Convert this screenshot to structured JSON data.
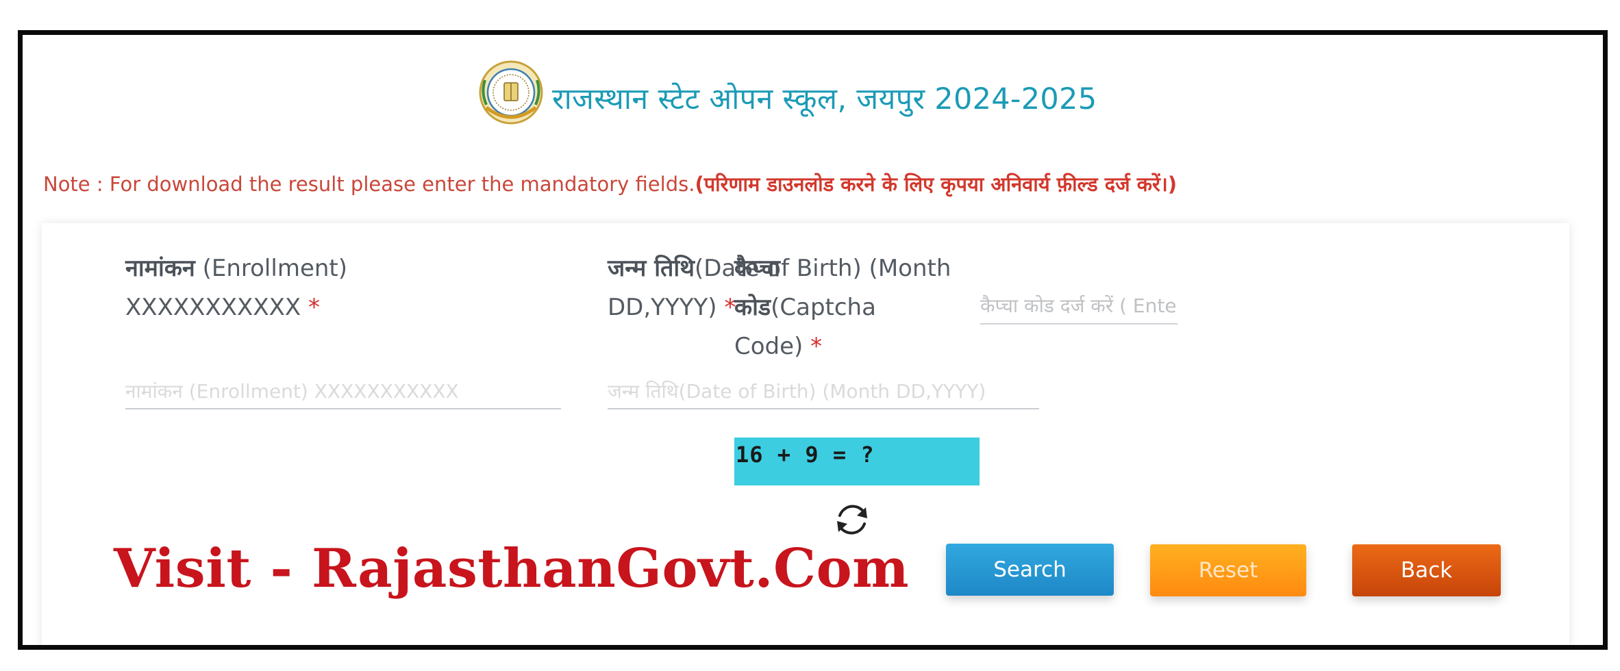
{
  "header": {
    "title": "राजस्थान स्टेट ओपन स्कूल, जयपुर 2024-2025",
    "logo_icon": "rsos-emblem-logo"
  },
  "note": {
    "prefix": "Note : For download the result please enter the mandatory fields.",
    "hindi": "(परिणाम डाउनलोड करने के लिए कृपया अनिवार्य फ़ील्ड दर्ज करें।)"
  },
  "form": {
    "enrollment": {
      "label_hi": "नामांकन",
      "label_en": " (Enrollment) XXXXXXXXXXX",
      "required": " *",
      "placeholder": "नामांकन (Enrollment) XXXXXXXXXXX",
      "value": ""
    },
    "dob": {
      "label_hi": "जन्म तिथि",
      "label_en": "(Date of Birth) (Month DD,YYYY)",
      "required": " *",
      "placeholder": "जन्म तिथि(Date of Birth) (Month DD,YYYY)",
      "value": ""
    },
    "captcha": {
      "label_hi": "कैप्चा कोड",
      "label_en": "(Captcha Code)",
      "required": " *",
      "placeholder": "कैप्चा कोड दर्ज करें ( Enter captcha )",
      "value": "",
      "challenge": "16 + 9 = ?",
      "refresh_icon": "refresh-icon"
    }
  },
  "buttons": {
    "search": "Search",
    "reset": "Reset",
    "back": "Back"
  },
  "watermark": "Visit - RajasthanGovt.Com",
  "colors": {
    "title": "#1b9bb6",
    "note": "#c9473a",
    "captcha_bg": "#3ccde0",
    "search": "#1e88c7",
    "reset": "#ff8a10",
    "back": "#c7440a",
    "watermark": "#c8141c"
  }
}
